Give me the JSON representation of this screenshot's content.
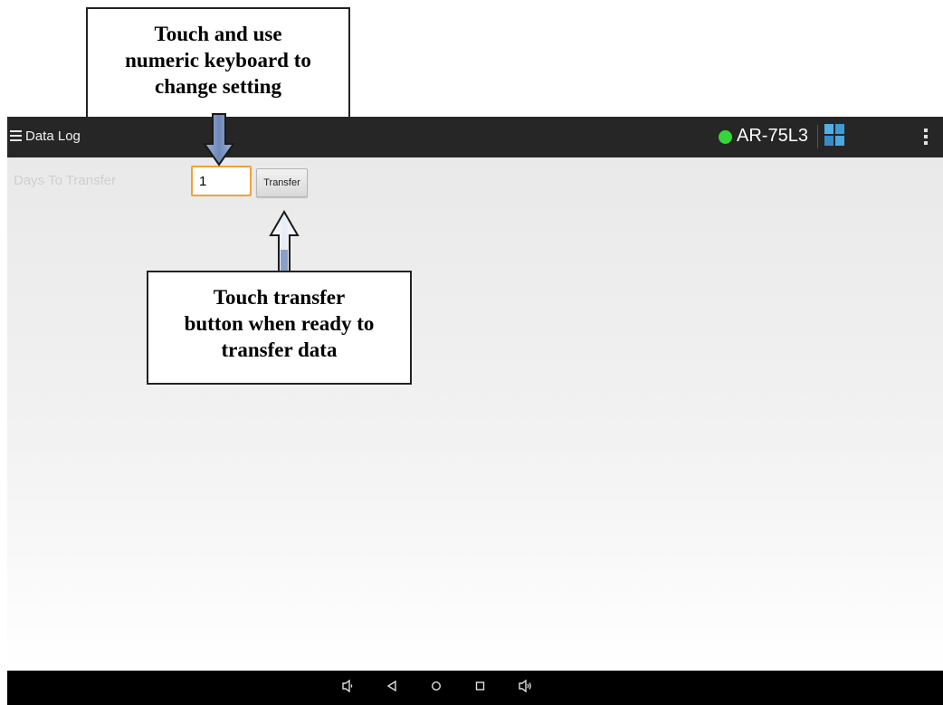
{
  "callouts": {
    "top": [
      "Touch and use",
      "numeric keyboard to",
      "change setting"
    ],
    "bottom": [
      "Touch transfer",
      "button when ready to",
      "transfer data"
    ]
  },
  "actionbar": {
    "title": "Data Log",
    "device_name": "AR-75L3",
    "status_color": "#34d63a",
    "icons": [
      "menu-icon",
      "connection-status-icon",
      "tiles-icon",
      "overflow-menu-icon"
    ]
  },
  "form": {
    "days_label": "Days To Transfer",
    "days_value": "1",
    "transfer_label": "Transfer"
  },
  "navbar": {
    "icons": [
      "volume-down-icon",
      "back-icon",
      "home-icon",
      "recents-icon",
      "volume-up-icon"
    ],
    "glyphs": {
      "volume_down": "◁",
      "back": "◁",
      "home": "○",
      "recents": "□",
      "volume_up": "◁"
    }
  },
  "colors": {
    "accent_input_border": "#f0a235",
    "actionbar_bg": "#262626",
    "arrow_fill": "#7c93bd"
  }
}
